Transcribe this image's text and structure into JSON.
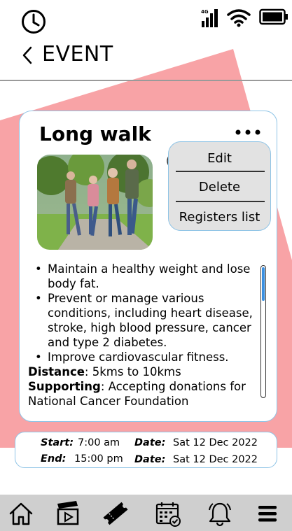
{
  "header": {
    "title": "EVENT"
  },
  "event": {
    "title": "Long walk",
    "benefits": [
      "Maintain a healthy weight and lose body fat.",
      "Prevent or manage various conditions, including heart disease, stroke, high blood pressure, cancer and type 2 diabetes.",
      "Improve cardiovascular fitness."
    ],
    "distance_label": "Distance",
    "distance_value": ": 5kms to 10kms",
    "supporting_label": "Supporting",
    "supporting_value": ": Accepting donations for National Cancer Foundation"
  },
  "menu": {
    "edit": "Edit",
    "delete": "Delete",
    "registers": "Registers list"
  },
  "schedule": {
    "start_label": "Start:",
    "start_time": "7:00 am",
    "end_label": "End:",
    "end_time": "15:00 pm",
    "date_label": "Date:",
    "start_date": "Sat 12 Dec 2022",
    "end_date": "Sat 12 Dec 2022"
  },
  "nav": {
    "icons": [
      "home-icon",
      "video-icon",
      "ticket-icon",
      "calendar-icon",
      "bell-icon",
      "menu-icon"
    ]
  },
  "colors": {
    "accent_shape": "#f8a3a6",
    "card_border": "#8fc4e6",
    "scroll_thumb": "#3a8fe0",
    "nav_bg": "#cfcfcf",
    "menu_bg": "#e2e2e2"
  }
}
